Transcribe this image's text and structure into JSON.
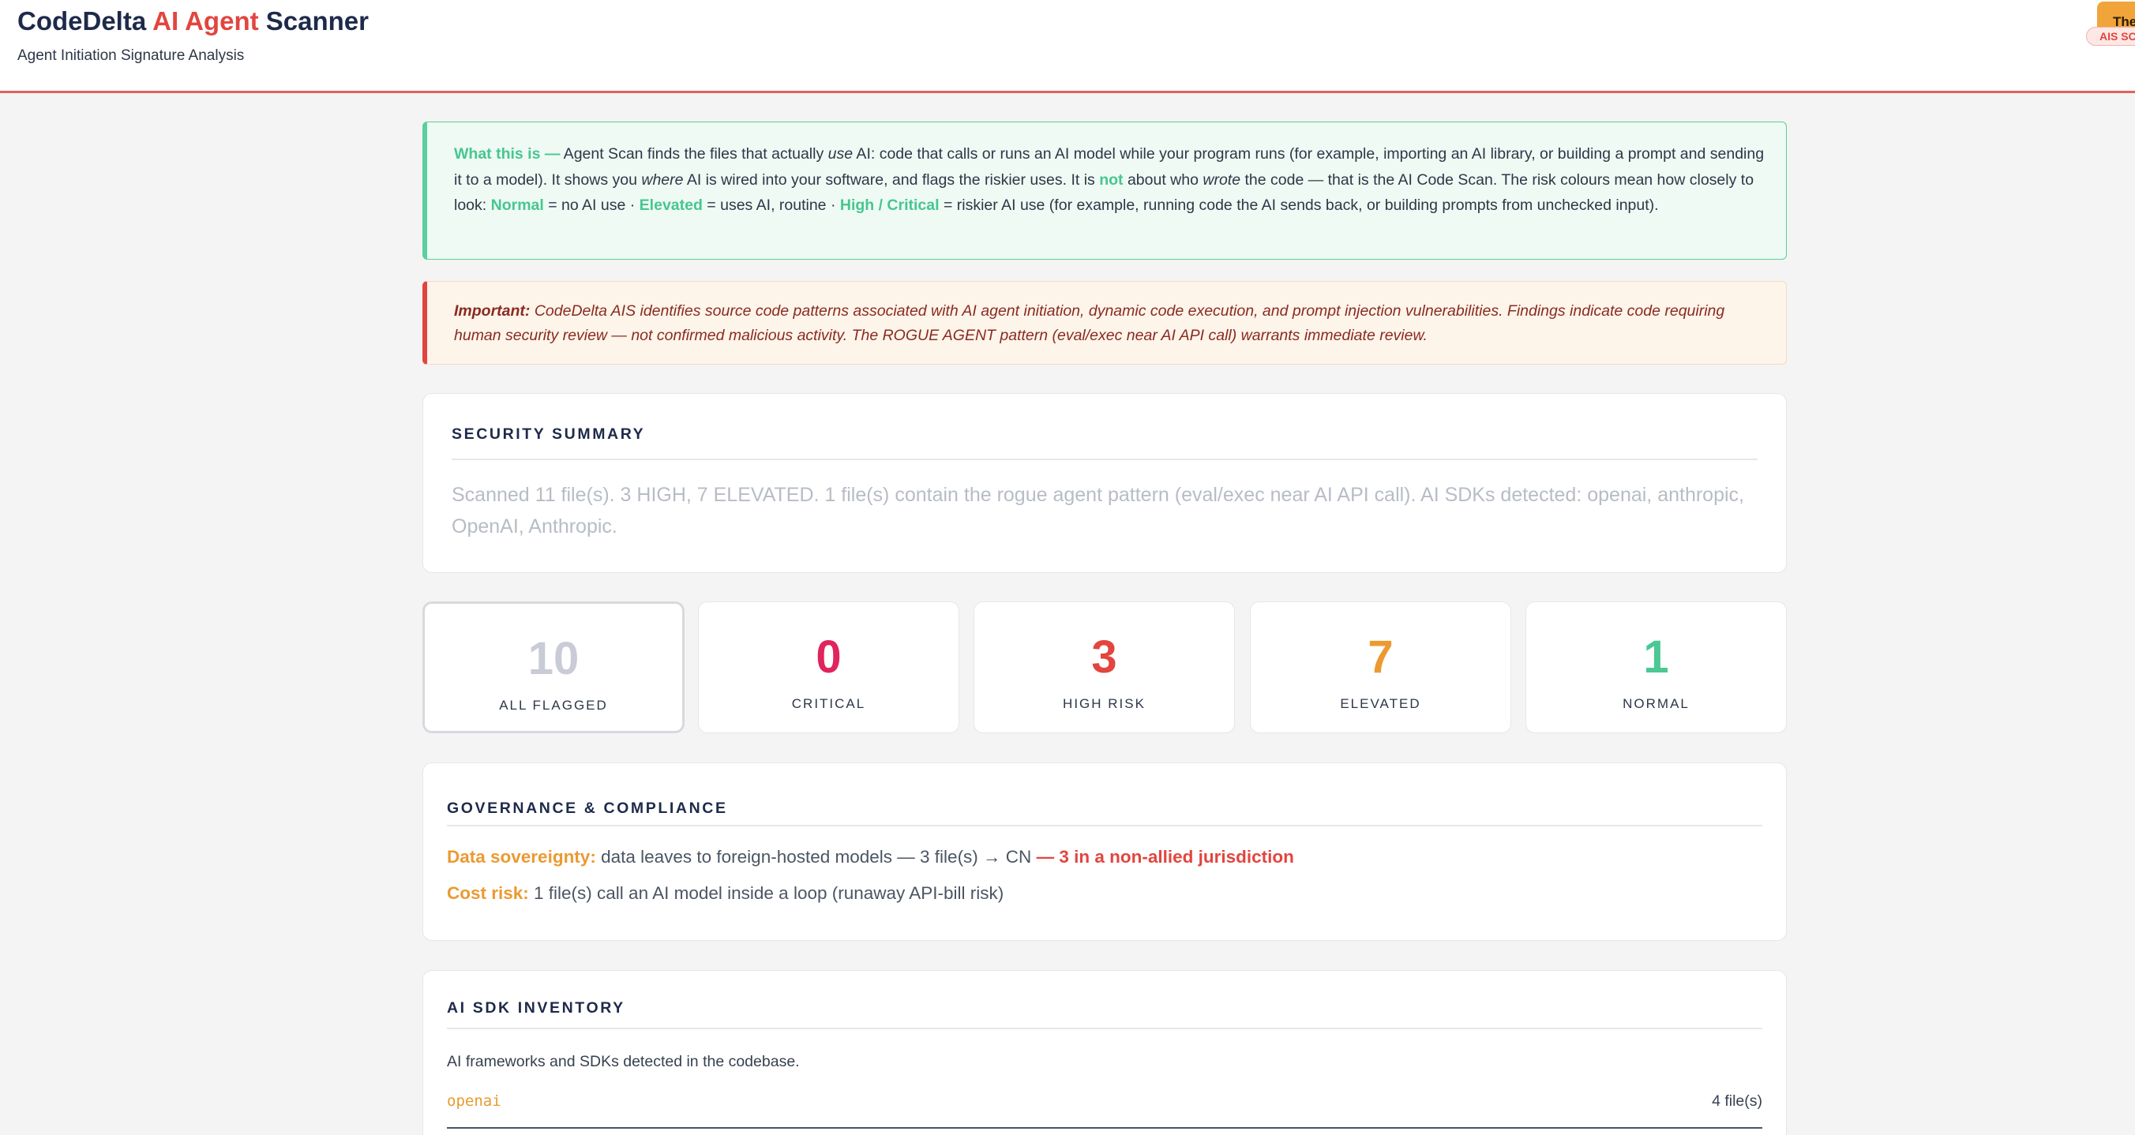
{
  "header": {
    "title_part1": "CodeDelta",
    "title_part2": "AI Agent",
    "title_part3": "Scanner",
    "subtitle": "Agent Initiation Signature Analysis",
    "theme_button": "Theme",
    "badge": "AIS SCAN"
  },
  "info": {
    "lead": "What this is —",
    "t1": " Agent Scan finds the files that actually ",
    "em1": "use",
    "t2": " AI: code that calls or runs an AI model while your program runs (for example, importing an AI library, or building a prompt and sending it to a model). It shows you ",
    "em2": "where",
    "t3": " AI is wired into your software, and flags the riskier uses. It is ",
    "not": "not",
    "t4": " about who ",
    "em3": "wrote",
    "t5": " the code — that is the AI Code Scan. The risk colours mean how closely to look: ",
    "normal": "Normal",
    "t6": " = no AI use · ",
    "elevated": "Elevated",
    "t7": " = uses AI, routine · ",
    "high": "High / Critical",
    "t8": " = riskier AI use (for example, running code the AI sends back, or building prompts from unchecked input)."
  },
  "warning": {
    "label": "Important:",
    "text": " CodeDelta AIS identifies source code patterns associated with AI agent initiation, dynamic code execution, and prompt injection vulnerabilities. Findings indicate code requiring human security review — not confirmed malicious activity. The ROGUE AGENT pattern (eval/exec near AI API call) warrants immediate review."
  },
  "summary": {
    "title": "SECURITY SUMMARY",
    "text": "Scanned 11 file(s). 3 HIGH, 7 ELEVATED. 1 file(s) contain the rogue agent pattern (eval/exec near AI API call). AI SDKs detected: openai, anthropic, OpenAI, Anthropic."
  },
  "stats": [
    {
      "value": "10",
      "label": "ALL FLAGGED",
      "color": "#c9ccd6"
    },
    {
      "value": "0",
      "label": "CRITICAL",
      "color": "#e0245e"
    },
    {
      "value": "3",
      "label": "HIGH RISK",
      "color": "#e2453f"
    },
    {
      "value": "7",
      "label": "ELEVATED",
      "color": "#eb9a31"
    },
    {
      "value": "1",
      "label": "NORMAL",
      "color": "#4cc893"
    }
  ],
  "governance": {
    "title": "GOVERNANCE & COMPLIANCE",
    "sovereignty_label": "Data sovereignty:",
    "sovereignty_text": " data leaves to foreign-hosted models — 3 file(s) → CN ",
    "sovereignty_alert": "— 3 in a non-allied jurisdiction",
    "cost_label": "Cost risk:",
    "cost_text": " 1 file(s) call an AI model inside a loop (runaway API-bill risk)"
  },
  "sdk": {
    "title": "AI SDK INVENTORY",
    "description": "AI frameworks and SDKs detected in the codebase.",
    "items": [
      {
        "name": "openai",
        "count": "4 file(s)"
      }
    ]
  }
}
